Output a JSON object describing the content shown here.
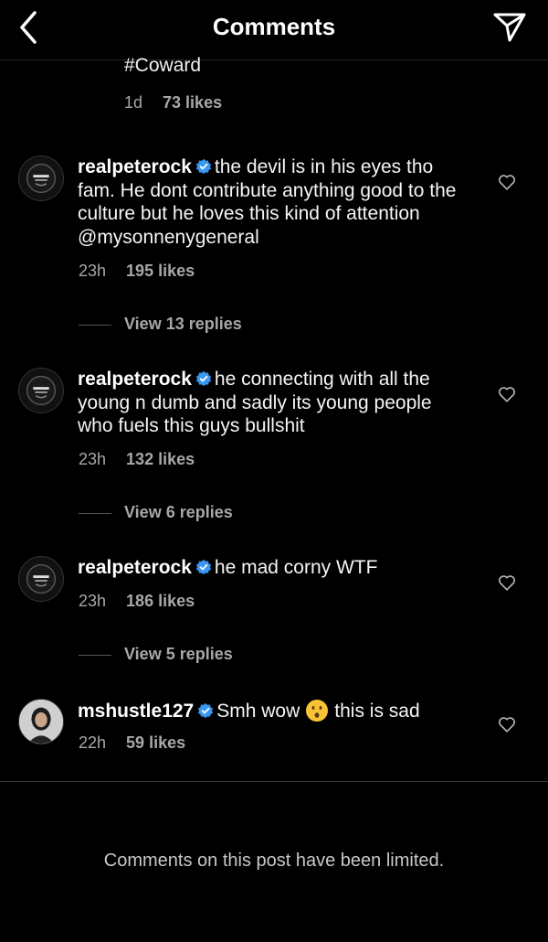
{
  "header": {
    "title": "Comments"
  },
  "previous_comment": {
    "text": "#Coward",
    "time": "1d",
    "likes": "73 likes"
  },
  "comments": [
    {
      "username": "realpeterock",
      "verified": true,
      "text": "the devil is in his eyes tho fam.  He dont contribute anything good to the culture but he loves this kind of attention @mysonnenygeneral",
      "time": "23h",
      "likes": "195 likes",
      "replies": "View 13 replies"
    },
    {
      "username": "realpeterock",
      "verified": true,
      "text": "he connecting with all the young n dumb and sadly its young people who fuels this guys bullshit",
      "time": "23h",
      "likes": "132 likes",
      "replies": "View 6 replies"
    },
    {
      "username": "realpeterock",
      "verified": true,
      "text": "he mad corny WTF",
      "time": "23h",
      "likes": "186 likes",
      "replies": "View 5 replies"
    },
    {
      "username": "mshustle127",
      "verified": true,
      "text_before_emoji": "Smh wow",
      "emoji": "hushed-face-emoji",
      "text_after_emoji": "this is sad",
      "time": "22h",
      "likes": "59 likes"
    }
  ],
  "footer": {
    "limited_notice": "Comments on this post have been limited."
  },
  "icons": {
    "back": "chevron-left-icon",
    "send": "paper-plane-icon",
    "like": "heart-outline-icon",
    "verified": "verified-badge-icon"
  },
  "colors": {
    "background": "#000000",
    "text": "#f5f5f5",
    "secondary": "#a8a8a8",
    "verified": "#3897f0"
  }
}
